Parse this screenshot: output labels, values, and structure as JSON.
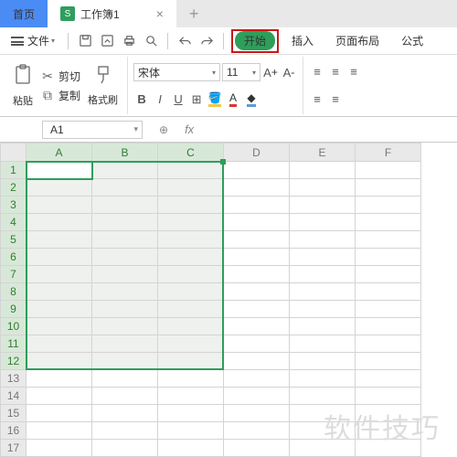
{
  "tabs": {
    "home": "首页",
    "workbook": "工作簿1",
    "wb_initial": "S"
  },
  "menu": {
    "file": "文件",
    "start": "开始",
    "insert": "插入",
    "layout": "页面布局",
    "formula": "公式"
  },
  "ribbon": {
    "paste": "粘贴",
    "cut": "剪切",
    "copy": "复制",
    "format": "格式刷",
    "font": "宋体",
    "size": "11"
  },
  "cell": {
    "ref": "A1"
  },
  "cols": [
    "A",
    "B",
    "C",
    "D",
    "E",
    "F"
  ],
  "rows": [
    "1",
    "2",
    "3",
    "4",
    "5",
    "6",
    "7",
    "8",
    "9",
    "10",
    "11",
    "12",
    "13",
    "14",
    "15",
    "16",
    "17"
  ],
  "watermark": "软件技巧"
}
